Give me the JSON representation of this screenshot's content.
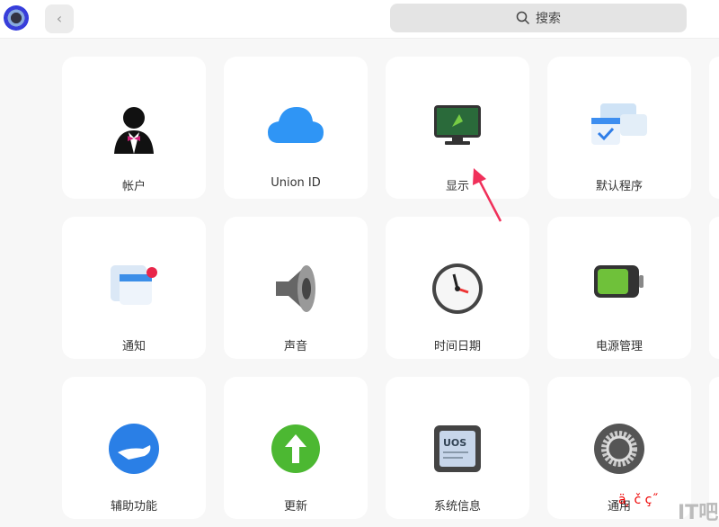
{
  "header": {
    "search_placeholder": "搜索",
    "icons": [
      "app-logo-icon",
      "back-chevron-icon",
      "search-icon"
    ]
  },
  "items": [
    {
      "label": "帐户",
      "icon": "account-icon"
    },
    {
      "label": "Union ID",
      "icon": "cloud-icon"
    },
    {
      "label": "显示",
      "icon": "monitor-icon"
    },
    {
      "label": "默认程序",
      "icon": "default-apps-icon"
    },
    {
      "label": "通知",
      "icon": "notification-icon"
    },
    {
      "label": "声音",
      "icon": "speaker-icon"
    },
    {
      "label": "时间日期",
      "icon": "clock-icon"
    },
    {
      "label": "电源管理",
      "icon": "battery-icon"
    },
    {
      "label": "辅助功能",
      "icon": "accessibility-icon"
    },
    {
      "label": "更新",
      "icon": "update-icon"
    },
    {
      "label": "系统信息",
      "icon": "system-info-icon"
    },
    {
      "label": "通用",
      "icon": "gear-icon"
    }
  ],
  "colors": {
    "annotation_arrow": "#f0305a"
  },
  "watermark": {
    "text": "IT吧",
    "garbled": "ä ̧ č ç˝"
  }
}
